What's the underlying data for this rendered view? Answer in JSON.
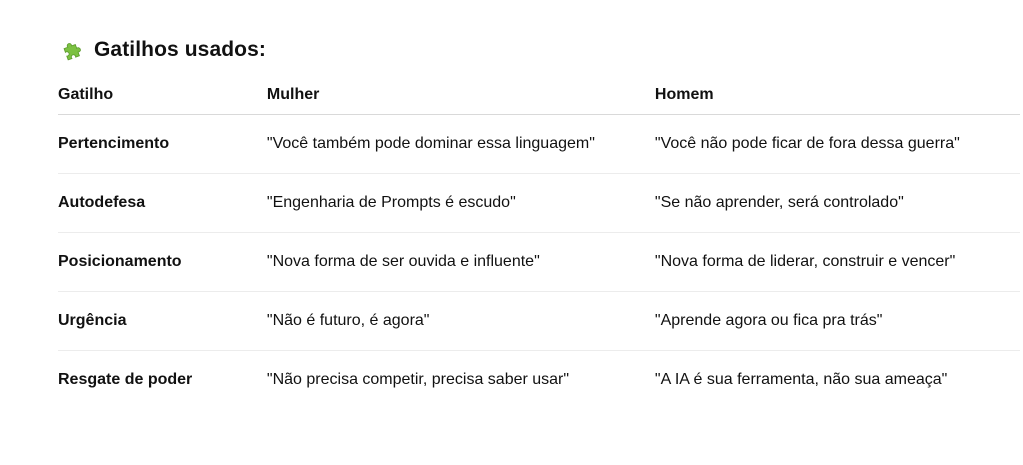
{
  "section": {
    "icon": "puzzle-piece-icon",
    "title": "Gatilhos usados:"
  },
  "table": {
    "headers": [
      "Gatilho",
      "Mulher",
      "Homem"
    ],
    "rows": [
      {
        "trigger": "Pertencimento",
        "woman": "\"Você também pode dominar essa linguagem\"",
        "man": "\"Você não pode ficar de fora dessa guerra\""
      },
      {
        "trigger": "Autodefesa",
        "woman": "\"Engenharia de Prompts é escudo\"",
        "man": "\"Se não aprender, será controlado\""
      },
      {
        "trigger": "Posicionamento",
        "woman": "\"Nova forma de ser ouvida e influente\"",
        "man": "\"Nova forma de liderar, construir e vencer\""
      },
      {
        "trigger": "Urgência",
        "woman": "\"Não é futuro, é agora\"",
        "man": "\"Aprende agora ou fica pra trás\""
      },
      {
        "trigger": "Resgate de poder",
        "woman": "\"Não precisa competir, precisa saber usar\"",
        "man": "\"A IA é sua ferramenta, não sua ameaça\""
      }
    ]
  },
  "colors": {
    "icon_green": "#7cc142",
    "icon_green_dark": "#5a9a2b",
    "text": "#111111",
    "border": "#d9d9d9"
  }
}
